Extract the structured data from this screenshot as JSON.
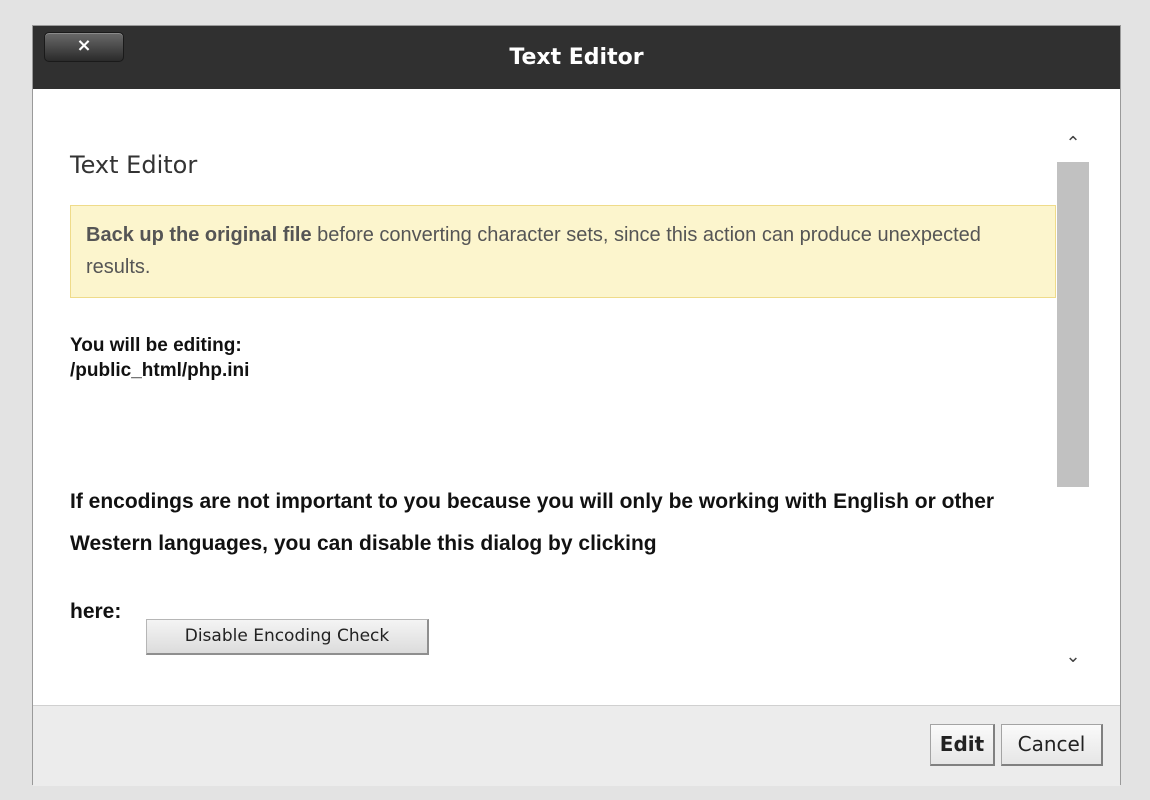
{
  "dialog": {
    "title": "Text Editor",
    "close_label": "×"
  },
  "content": {
    "heading": "Text Editor",
    "warning": {
      "bold": "Back up the original file",
      "rest": " before converting character sets, since this action can produce unexpected results."
    },
    "editing_label": "You will be editing:",
    "file_path": "/public_html/php.ini",
    "info_text": "If encodings are not important to you because you will only be working with English or other Western languages, you can disable this dialog by clicking",
    "here_label": "here:",
    "disable_button_label": "Disable Encoding Check"
  },
  "scrollbar": {
    "up_icon": "chevron-up",
    "up_glyph": "⌃",
    "down_icon": "chevron-down",
    "down_glyph": "⌄"
  },
  "footer": {
    "edit_label": "Edit",
    "cancel_label": "Cancel"
  },
  "colors": {
    "titlebar": "#303030",
    "warning_bg": "#fcf5cd",
    "warning_border": "#efdb8a",
    "footer_bg": "#ececec",
    "page_bg": "#e3e3e3"
  }
}
